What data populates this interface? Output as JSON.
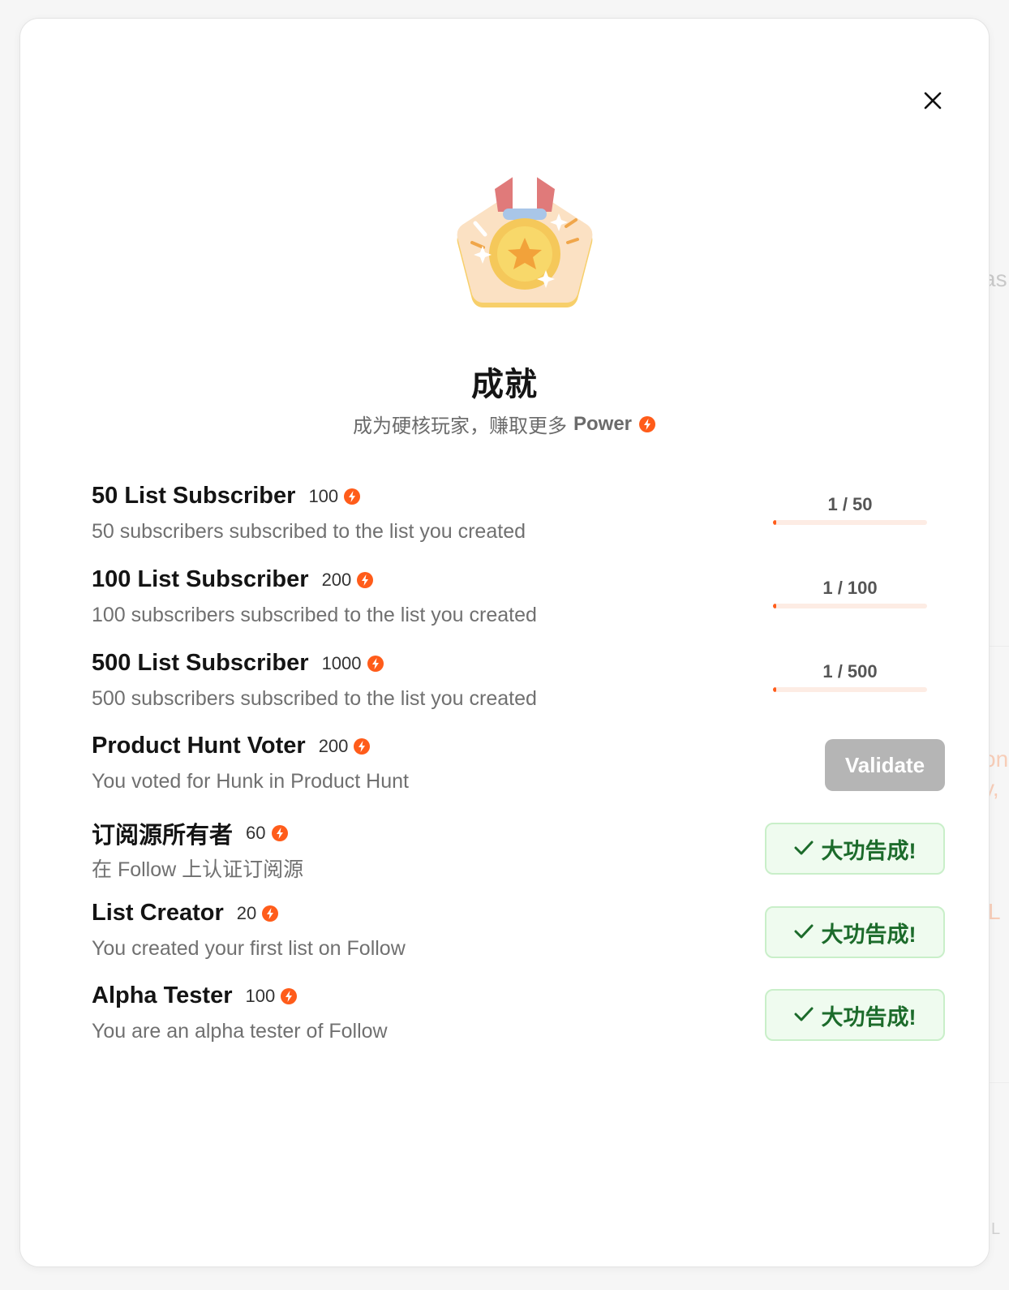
{
  "background": {
    "fragments": [
      "as",
      "on",
      "y,",
      "L",
      "L"
    ]
  },
  "modal": {
    "close_icon": "close-icon",
    "hero_icon": "medal-icon",
    "title": "成就",
    "subtitle": "成为硬核玩家，赚取更多",
    "subtitle_power": "Power",
    "power_icon": "lightning-coin-icon",
    "accent_color": "#ff5c1a"
  },
  "achievements": [
    {
      "name": "50 List Subscriber",
      "points": "100",
      "description": "50 subscribers subscribed to the list you created",
      "status": "progress",
      "progress_text": "1 / 50",
      "progress_fraction": 0.02
    },
    {
      "name": "100 List Subscriber",
      "points": "200",
      "description": "100 subscribers subscribed to the list you created",
      "status": "progress",
      "progress_text": "1 / 100",
      "progress_fraction": 0.01
    },
    {
      "name": "500 List Subscriber",
      "points": "1000",
      "description": "500 subscribers subscribed to the list you created",
      "status": "progress",
      "progress_text": "1 / 500",
      "progress_fraction": 0.002
    },
    {
      "name": "Product Hunt Voter",
      "points": "200",
      "description": "You voted for Hunk in Product Hunt",
      "status": "validate",
      "action_label": "Validate"
    },
    {
      "name": "订阅源所有者",
      "points": "60",
      "description": "在 Follow 上认证订阅源",
      "status": "done",
      "done_label": "大功告成!"
    },
    {
      "name": "List Creator",
      "points": "20",
      "description": "You created your first list on Follow",
      "status": "done",
      "done_label": "大功告成!"
    },
    {
      "name": "Alpha Tester",
      "points": "100",
      "description": "You are an alpha tester of Follow",
      "status": "done",
      "done_label": "大功告成!"
    }
  ]
}
